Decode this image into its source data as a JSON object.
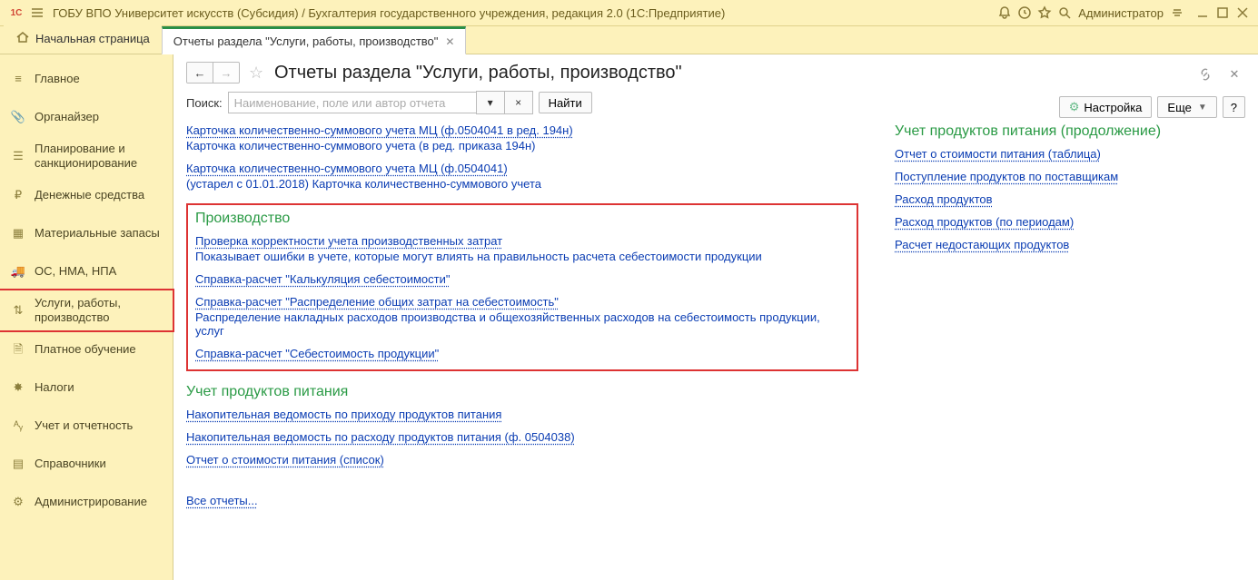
{
  "titlebar": {
    "title": "ГОБУ ВПО Университет искусств (Субсидия) / Бухгалтерия государственного учреждения, редакция 2.0  (1С:Предприятие)",
    "user": "Администратор"
  },
  "tabs": {
    "home": "Начальная страница",
    "active": "Отчеты раздела \"Услуги, работы, производство\""
  },
  "sidebar": {
    "items": [
      {
        "icon": "list",
        "label": "Главное"
      },
      {
        "icon": "clip",
        "label": "Органайзер"
      },
      {
        "icon": "plan",
        "label": "Планирование и санкционирование"
      },
      {
        "icon": "coin",
        "label": "Денежные средства"
      },
      {
        "icon": "boxes",
        "label": "Материальные запасы"
      },
      {
        "icon": "truck",
        "label": "ОС, НМА, НПА"
      },
      {
        "icon": "sliders",
        "label": "Услуги, работы, производство"
      },
      {
        "icon": "doc",
        "label": "Платное обучение"
      },
      {
        "icon": "eagle",
        "label": "Налоги"
      },
      {
        "icon": "report",
        "label": "Учет и отчетность"
      },
      {
        "icon": "book",
        "label": "Справочники"
      },
      {
        "icon": "gear",
        "label": "Администрирование"
      }
    ]
  },
  "page": {
    "title": "Отчеты раздела \"Услуги, работы, производство\"",
    "search_label": "Поиск:",
    "search_placeholder": "Наименование, поле или автор отчета",
    "find_btn": "Найти",
    "settings_btn": "Настройка",
    "more_btn": "Еще",
    "help_btn": "?"
  },
  "top_reports": [
    {
      "title": "Карточка количественно-суммового учета МЦ  (ф.0504041 в ред. 194н)",
      "desc": "Карточка количественно-суммового учета (в ред. приказа 194н)"
    },
    {
      "title": "Карточка количественно-суммового учета МЦ  (ф.0504041)",
      "desc": "(устарел с 01.01.2018) Карточка количественно-суммового учета"
    }
  ],
  "groups": {
    "production": {
      "title": "Производство",
      "items": [
        {
          "title": "Проверка корректности учета производственных затрат",
          "desc": "Показывает ошибки в учете, которые могут влиять на правильность расчета себестоимости продукции"
        },
        {
          "title": "Справка-расчет \"Калькуляция себестоимости\""
        },
        {
          "title": "Справка-расчет \"Распределение общих затрат на себестоимость\"",
          "desc": "Распределение накладных расходов производства и общехозяйственных расходов на себестоимость продукции, услуг"
        },
        {
          "title": "Справка-расчет \"Себестоимость продукции\""
        }
      ]
    },
    "food": {
      "title": "Учет продуктов питания",
      "items": [
        {
          "title": "Накопительная ведомость по приходу продуктов питания"
        },
        {
          "title": "Накопительная ведомость по расходу продуктов питания (ф. 0504038)"
        },
        {
          "title": "Отчет о стоимости питания (список)"
        }
      ]
    },
    "food_cont": {
      "title": "Учет продуктов питания (продолжение)",
      "items": [
        {
          "title": "Отчет о стоимости питания (таблица)"
        },
        {
          "title": "Поступление продуктов по поставщикам"
        },
        {
          "title": "Расход продуктов"
        },
        {
          "title": "Расход продуктов (по периодам)"
        },
        {
          "title": "Расчет недостающих продуктов"
        }
      ]
    }
  },
  "all_reports": "Все отчеты..."
}
